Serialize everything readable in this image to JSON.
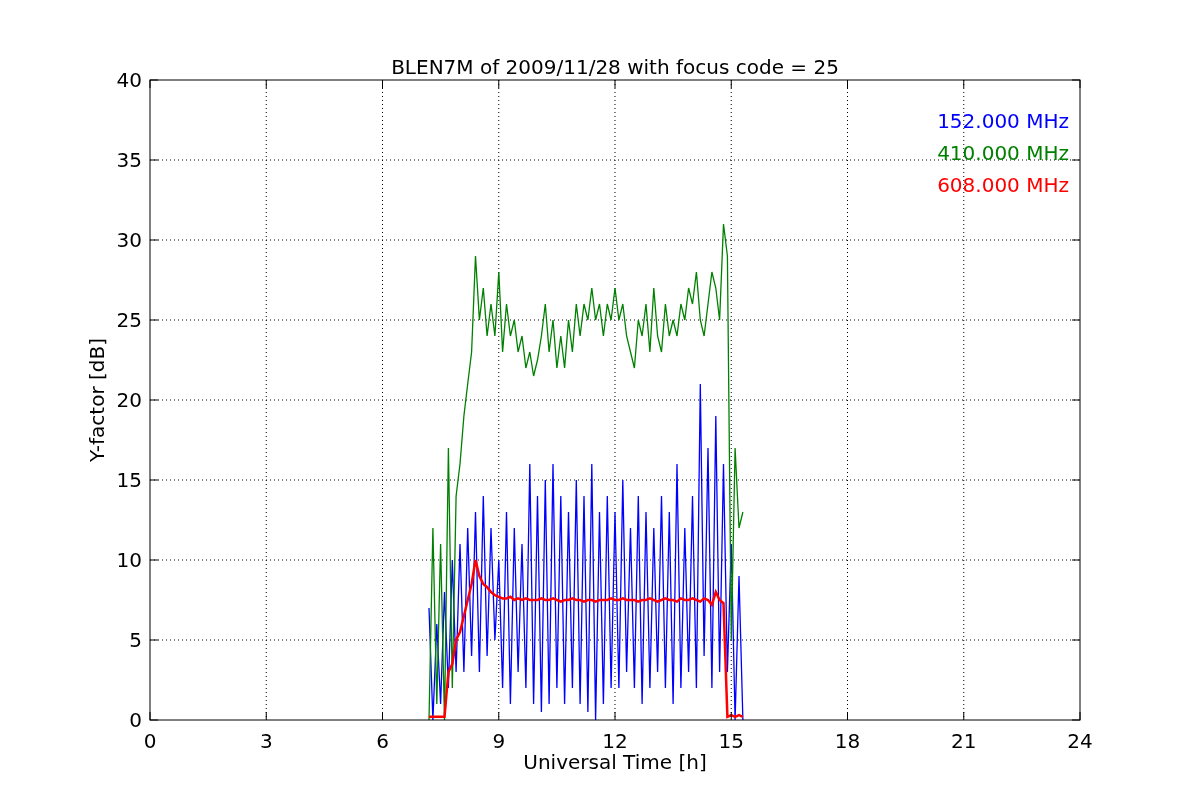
{
  "chart_data": {
    "type": "line",
    "title": "BLEN7M of 2009/11/28 with focus code = 25",
    "xlabel": "Universal Time [h]",
    "ylabel": "Y-factor [dB]",
    "x": [
      7.2,
      7.3,
      7.4,
      7.5,
      7.6,
      7.7,
      7.8,
      7.9,
      8.0,
      8.1,
      8.2,
      8.3,
      8.4,
      8.5,
      8.6,
      8.7,
      8.8,
      8.9,
      9.0,
      9.1,
      9.2,
      9.3,
      9.4,
      9.5,
      9.6,
      9.7,
      9.8,
      9.9,
      10.0,
      10.1,
      10.2,
      10.3,
      10.4,
      10.5,
      10.6,
      10.7,
      10.8,
      10.9,
      11.0,
      11.1,
      11.2,
      11.3,
      11.4,
      11.5,
      11.6,
      11.7,
      11.8,
      11.9,
      12.0,
      12.1,
      12.2,
      12.3,
      12.4,
      12.5,
      12.6,
      12.7,
      12.8,
      12.9,
      13.0,
      13.1,
      13.2,
      13.3,
      13.4,
      13.5,
      13.6,
      13.7,
      13.8,
      13.9,
      14.0,
      14.1,
      14.2,
      14.3,
      14.4,
      14.5,
      14.6,
      14.7,
      14.8,
      14.9,
      15.0,
      15.1,
      15.2,
      15.3
    ],
    "series": [
      {
        "name": "152.000 MHz",
        "color": "#0000ff",
        "values": [
          7,
          0,
          6,
          1,
          8,
          2,
          10,
          3,
          11,
          3,
          12,
          4,
          13,
          3,
          14,
          4,
          12,
          5,
          10,
          2,
          13,
          1,
          12,
          3,
          11,
          2,
          16,
          1,
          14,
          0.5,
          15,
          1,
          16,
          2,
          14,
          1,
          13,
          2,
          15,
          1,
          14,
          0.5,
          16,
          0,
          13,
          1,
          14,
          2,
          13,
          2,
          15,
          3,
          12,
          2,
          14,
          1,
          13,
          2,
          12,
          3,
          14,
          2,
          13,
          1,
          16,
          2,
          12,
          3,
          14,
          2,
          21,
          4,
          17,
          2,
          19,
          3,
          16,
          3,
          11,
          0,
          9,
          0
        ]
      },
      {
        "name": "410.000 MHz",
        "color": "#008000",
        "values": [
          0,
          12,
          1,
          11,
          0,
          17,
          2,
          14,
          16,
          19,
          21,
          23,
          29,
          25,
          27,
          24,
          26,
          24,
          28,
          23,
          26,
          24,
          25,
          23,
          24,
          22,
          23,
          21.5,
          22.5,
          24,
          26,
          23,
          25,
          22,
          24,
          22,
          25,
          23,
          26,
          24,
          26,
          25,
          27,
          25,
          26,
          24,
          26,
          25,
          27,
          25,
          26,
          24,
          23,
          22,
          25,
          24,
          26,
          23,
          27,
          24,
          23,
          26,
          24,
          25,
          24,
          26,
          25,
          27,
          26,
          28,
          25,
          24,
          26,
          28,
          27,
          25,
          31,
          29,
          5,
          17,
          12,
          13
        ]
      },
      {
        "name": "608.000 MHz",
        "color": "#ff0000",
        "values": [
          0.2,
          0.2,
          0.2,
          0.2,
          0.2,
          3,
          3.5,
          5,
          5.5,
          6.5,
          7.5,
          8.5,
          10,
          9,
          8.5,
          8.3,
          8,
          7.8,
          7.7,
          7.6,
          7.6,
          7.7,
          7.5,
          7.6,
          7.5,
          7.6,
          7.5,
          7.5,
          7.5,
          7.6,
          7.5,
          7.5,
          7.6,
          7.5,
          7.4,
          7.5,
          7.5,
          7.6,
          7.5,
          7.5,
          7.4,
          7.5,
          7.5,
          7.4,
          7.5,
          7.5,
          7.5,
          7.6,
          7.5,
          7.5,
          7.6,
          7.5,
          7.5,
          7.5,
          7.4,
          7.5,
          7.5,
          7.6,
          7.5,
          7.4,
          7.5,
          7.6,
          7.5,
          7.5,
          7.4,
          7.6,
          7.5,
          7.5,
          7.6,
          7.5,
          7.4,
          7.6,
          7.5,
          7.2,
          8,
          7.5,
          7.3,
          0.2,
          0.3,
          0.2,
          0.3,
          0.2
        ]
      }
    ],
    "grid": true,
    "xlim": [
      0,
      24
    ],
    "ylim": [
      0,
      40
    ],
    "xticks": [
      0,
      3,
      6,
      9,
      12,
      15,
      18,
      21,
      24
    ],
    "yticks": [
      0,
      5,
      10,
      15,
      20,
      25,
      30,
      35,
      40
    ]
  }
}
